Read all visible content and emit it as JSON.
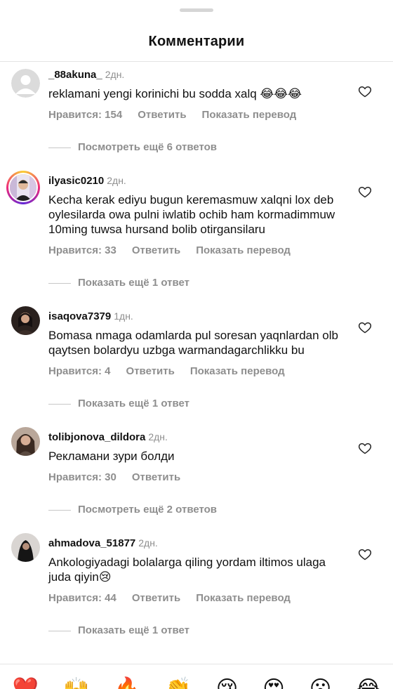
{
  "header": {
    "title": "Комментарии"
  },
  "comments": [
    {
      "username": "_88akuna_",
      "time": "2дн.",
      "text": "reklamani yengi korinichi bu sodda xalq 😂😂😂",
      "likes": "Нравится: 154",
      "reply": "Ответить",
      "translate": "Показать перевод",
      "replies": "Посмотреть ещё 6 ответов"
    },
    {
      "username": "ilyasic0210",
      "time": "2дн.",
      "text": "Kecha kerak ediyu bugun keremasmuw  xalqni lox deb oylesilarda owa pulni iwlatib  ochib ham kormadimmuw 10ming tuwsa hursand bolib otirgansilaru",
      "likes": "Нравится: 33",
      "reply": "Ответить",
      "translate": "Показать перевод",
      "replies": "Показать ещё 1 ответ"
    },
    {
      "username": "isaqova7379",
      "time": "1дн.",
      "text": "Bomasa nmaga odamlarda pul soresan yaqnlardan olb qaytsen bolardyu uzbga warmandagarchlikku bu",
      "likes": "Нравится: 4",
      "reply": "Ответить",
      "translate": "Показать перевод",
      "replies": "Показать ещё 1 ответ"
    },
    {
      "username": "tolibjonova_dildora",
      "time": "2дн.",
      "text": "Рекламани зури болди",
      "likes": "Нравится: 30",
      "reply": "Ответить",
      "replies": "Посмотреть ещё 2 ответов"
    },
    {
      "username": "ahmadova_51877",
      "time": "2дн.",
      "text": "Ankologiyadagi bolalarga qiling yordam iltimos ulaga juda qiyin😢",
      "likes": "Нравится: 44",
      "reply": "Ответить",
      "translate": "Показать перевод",
      "replies": "Показать ещё 1 ответ"
    }
  ],
  "emoji_bar": [
    "❤️",
    "🙌",
    "🔥",
    "👏",
    "😢",
    "😍",
    "😮",
    "😂"
  ]
}
